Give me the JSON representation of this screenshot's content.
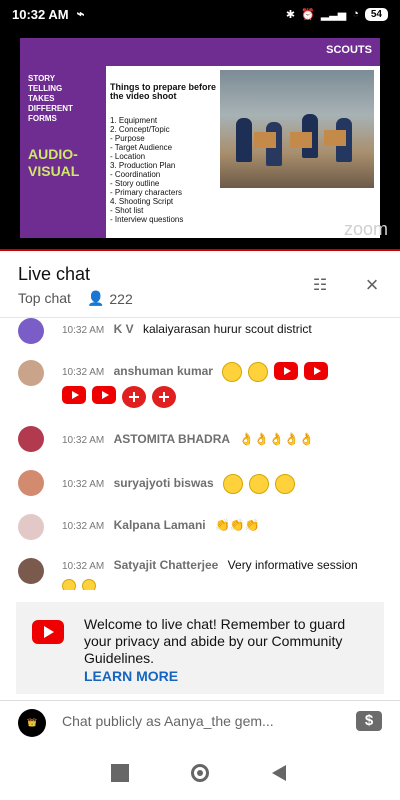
{
  "status_bar": {
    "time": "10:32 AM",
    "battery": "54"
  },
  "video": {
    "brand": "SCOUTS",
    "side_small": "STORY\nTELLING\nTAKES\nDIFFERENT\nFORMS",
    "side_big": "AUDIO-\nVISUAL",
    "slide_title": "Things to prepare before the video shoot",
    "slide_lines": "1. Equipment\n2. Concept/Topic\n - Purpose\n - Target Audience\n - Location\n3. Production Plan\n - Coordination\n - Story outline\n - Primary characters\n4. Shooting Script\n - Shot list\n - Interview questions",
    "watermark": "zoom"
  },
  "chat": {
    "title": "Live chat",
    "mode": "Top chat",
    "viewer_count": "222"
  },
  "messages": [
    {
      "time": "10:32 AM",
      "author": "K V",
      "text": "kalaiyarasan hurur scout district"
    },
    {
      "time": "10:32 AM",
      "author": "anshuman kumar",
      "text": ""
    },
    {
      "time": "10:32 AM",
      "author": "ASTOMITA BHADRA",
      "text": "👌👌👌👌👌"
    },
    {
      "time": "10:32 AM",
      "author": "suryajyoti biswas",
      "text": ""
    },
    {
      "time": "10:32 AM",
      "author": "Kalpana Lamani",
      "text": "👏👏👏"
    },
    {
      "time": "10:32 AM",
      "author": "Satyajit Chatterjee",
      "text": "Very informative session"
    }
  ],
  "notice": {
    "text": "Welcome to live chat! Remember to guard your privacy and abide by our Community Guidelines.",
    "link": "LEARN MORE"
  },
  "composer": {
    "placeholder": "Chat publicly as Aanya_the gem..."
  }
}
